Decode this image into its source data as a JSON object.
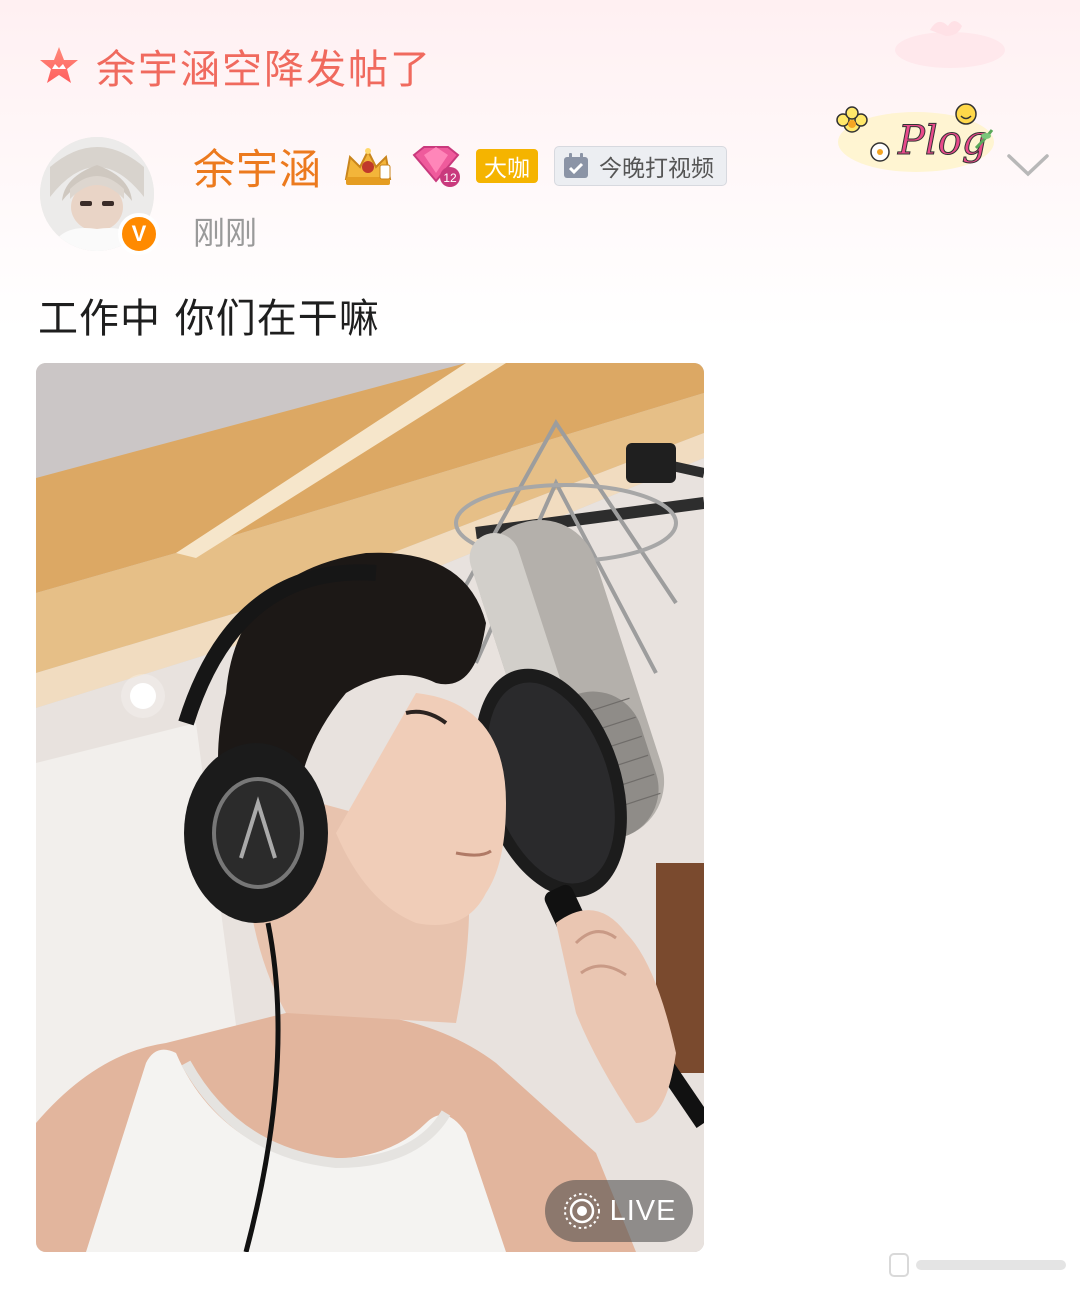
{
  "promo_banner": {
    "icon": "star-crown-icon",
    "text": "余宇涵空降发帖了"
  },
  "post": {
    "author": {
      "name": "余宇涵",
      "verified": true,
      "verified_mark": "V",
      "badges": {
        "crown_icon": "crown-fan-badge-icon",
        "gem_level": "12",
        "tier_label": "大咖",
        "task_label": "今晚打视频"
      }
    },
    "time": "刚刚",
    "sticker_text": "Plog",
    "content": "工作中 你们在干嘛",
    "media": {
      "description_icon": "photo",
      "live_label": "LIVE"
    }
  },
  "colors": {
    "promo_text": "#f06a5e",
    "username": "#ec7a1e",
    "tier_badge": "#f5b400",
    "verified": "#ff8a00"
  }
}
